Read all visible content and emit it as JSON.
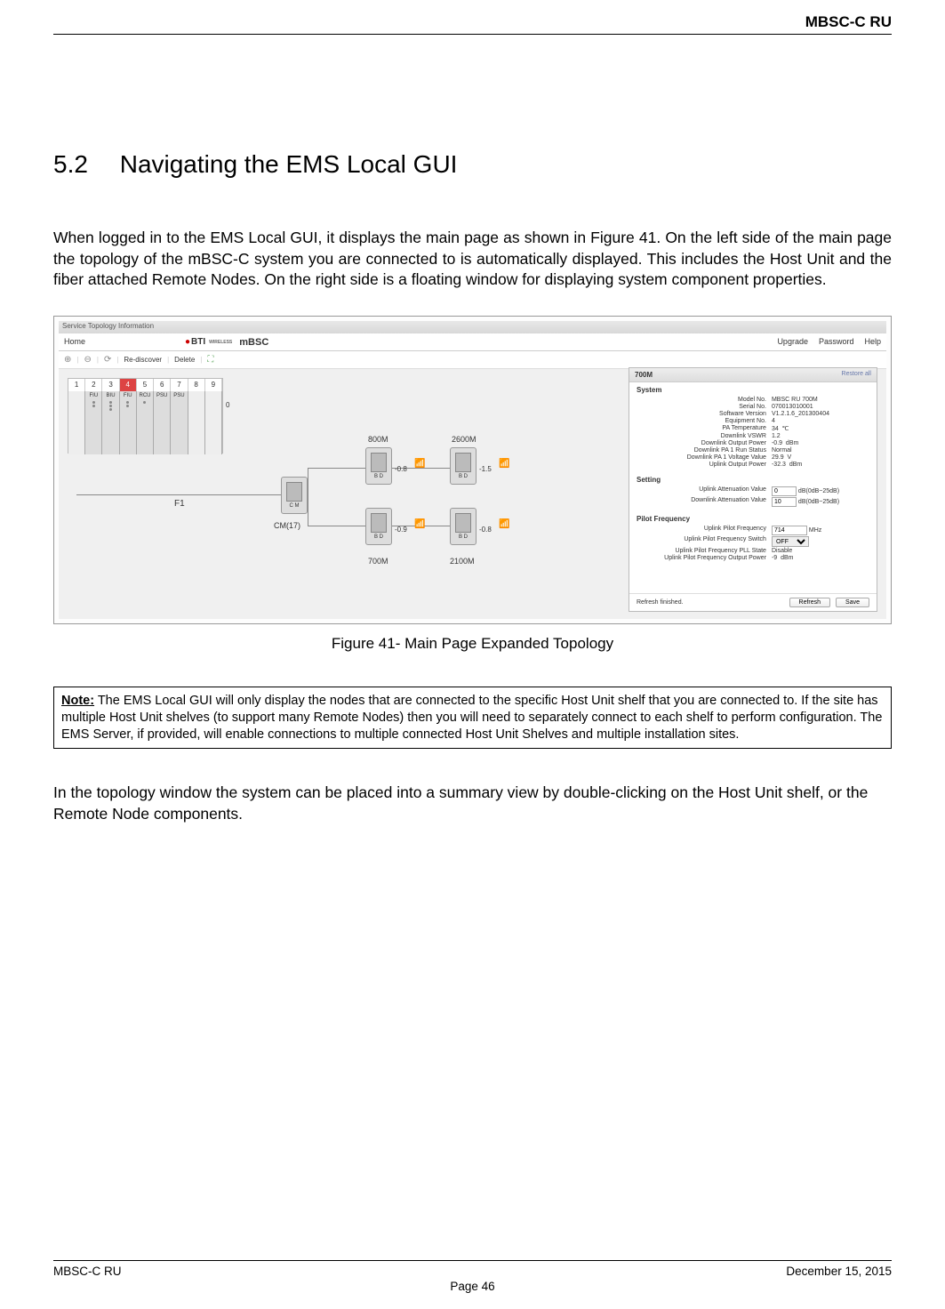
{
  "header": {
    "title": "MBSC-C RU"
  },
  "section": {
    "number": "5.2",
    "title": "Navigating the EMS Local GUI"
  },
  "para1": "When logged in to the EMS Local GUI, it displays the main page as shown in Figure 41. On the left side of the main page the topology of the mBSC-C system you are connected to is automatically displayed. This includes the Host Unit and the fiber attached Remote Nodes. On the right side is a floating window for displaying system component properties.",
  "screenshot": {
    "window_title": "Service Topology Information",
    "menu": {
      "home": "Home",
      "upgrade": "Upgrade",
      "password": "Password",
      "help": "Help"
    },
    "logo": {
      "brand": "BTI",
      "brand_sub": "WIRELESS",
      "product": "mBSC"
    },
    "toolbar": {
      "rediscover": "Re-discover",
      "delete": "Delete"
    },
    "shelf": {
      "slots": [
        "1",
        "2",
        "3",
        "4",
        "5",
        "6",
        "7",
        "8",
        "9"
      ],
      "active": "4",
      "cards": [
        "",
        "FIU",
        "BIU",
        "FIU",
        "RCU",
        "PSU",
        "PSU",
        "",
        ""
      ],
      "port_label": "0",
      "label": "F1"
    },
    "topology": {
      "cm_label": "CM(17)",
      "bands": {
        "b800": "800M",
        "b2600": "2600M",
        "b700": "700M",
        "b2100": "2100M"
      },
      "powers": {
        "p800": "-0.8",
        "p2600": "-1.5",
        "p700": "-0.9",
        "p2100": "-0.8"
      },
      "node_bd": "B D",
      "node_cm": "C M"
    },
    "panel": {
      "title": "700M",
      "restore": "Restore all",
      "sections": {
        "system": "System",
        "setting": "Setting",
        "pilot": "Pilot Frequency"
      },
      "system": {
        "model_no_k": "Model No.",
        "model_no_v": "MBSC RU 700M",
        "serial_no_k": "Serial No.",
        "serial_no_v": "070013010001",
        "sw_k": "Software Version",
        "sw_v": "V1.2.1.6_201300404",
        "eq_k": "Equipment No.",
        "eq_v": "4",
        "pa_temp_k": "PA Temperature",
        "pa_temp_v": "34",
        "pa_temp_u": "℃",
        "dl_vswr_k": "Downlink VSWR",
        "dl_vswr_v": "1.2",
        "dl_out_k": "Downlink Output Power",
        "dl_out_v": "-0.9",
        "dl_out_u": "dBm",
        "pa_run_k": "Downlink PA 1 Run Status",
        "pa_run_v": "Normal",
        "pa_volt_k": "Downlink PA 1 Voltage Value",
        "pa_volt_v": "29.9",
        "pa_volt_u": "V",
        "ul_out_k": "Uplink Output Power",
        "ul_out_v": "-32.3",
        "ul_out_u": "dBm"
      },
      "setting": {
        "ul_att_k": "Uplink Attenuation Value",
        "ul_att_v": "0",
        "ul_att_u": "dB(0dB~25dB)",
        "dl_att_k": "Downlink Attenuation Value",
        "dl_att_v": "10",
        "dl_att_u": "dB(0dB~25dB)"
      },
      "pilot": {
        "freq_k": "Uplink Pilot Frequency",
        "freq_v": "714",
        "freq_u": "MHz",
        "switch_k": "Uplink Pilot Frequency Switch",
        "switch_v": "OFF",
        "pll_k": "Uplink Pilot Frequency PLL State",
        "pll_v": "Disable",
        "out_k": "Uplink Pilot Frequency Output Power",
        "out_v": "-9",
        "out_u": "dBm"
      },
      "footer": {
        "status": "Refresh finished.",
        "refresh": "Refresh",
        "save": "Save"
      }
    }
  },
  "figure_caption": "Figure 41- Main Page Expanded Topology",
  "note": {
    "label": "Note:",
    "text": " The EMS Local GUI will only display the nodes that are connected to the specific Host Unit shelf that you are connected to. If the site has multiple Host Unit shelves (to support many Remote Nodes) then you will need to separately connect to each shelf to perform configuration. The EMS Server, if provided, will enable connections to multiple connected Host Unit Shelves and multiple installation sites."
  },
  "para2": "In the topology window the system can be placed into a summary view by double-clicking on the Host Unit shelf, or the Remote Node components.",
  "footer": {
    "left": "MBSC-C RU",
    "right": "December 15, 2015",
    "page": "Page 46"
  }
}
